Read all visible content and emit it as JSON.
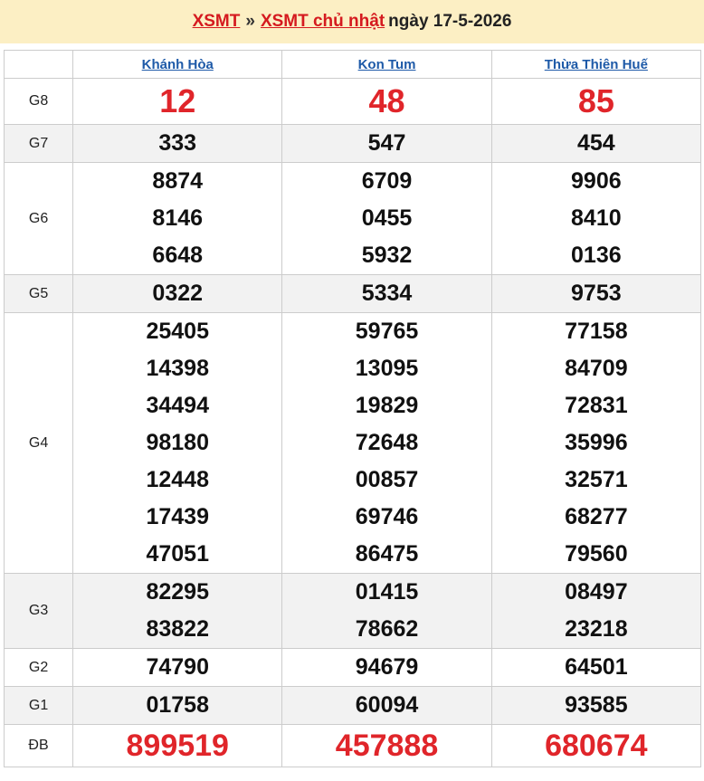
{
  "header": {
    "link1": "XSMT",
    "separator": "»",
    "link2": "XSMT chủ nhật",
    "date_text": "ngày 17-5-2026"
  },
  "provinces": [
    "Khánh Hòa",
    "Kon Tum",
    "Thừa Thiên Huế"
  ],
  "prizes": [
    {
      "label": "G8",
      "values": [
        [
          "12"
        ],
        [
          "48"
        ],
        [
          "85"
        ]
      ]
    },
    {
      "label": "G7",
      "values": [
        [
          "333"
        ],
        [
          "547"
        ],
        [
          "454"
        ]
      ]
    },
    {
      "label": "G6",
      "values": [
        [
          "8874",
          "8146",
          "6648"
        ],
        [
          "6709",
          "0455",
          "5932"
        ],
        [
          "9906",
          "8410",
          "0136"
        ]
      ]
    },
    {
      "label": "G5",
      "values": [
        [
          "0322"
        ],
        [
          "5334"
        ],
        [
          "9753"
        ]
      ]
    },
    {
      "label": "G4",
      "values": [
        [
          "25405",
          "14398",
          "34494",
          "98180",
          "12448",
          "17439",
          "47051"
        ],
        [
          "59765",
          "13095",
          "19829",
          "72648",
          "00857",
          "69746",
          "86475"
        ],
        [
          "77158",
          "84709",
          "72831",
          "35996",
          "32571",
          "68277",
          "79560"
        ]
      ]
    },
    {
      "label": "G3",
      "values": [
        [
          "82295",
          "83822"
        ],
        [
          "01415",
          "78662"
        ],
        [
          "08497",
          "23218"
        ]
      ]
    },
    {
      "label": "G2",
      "values": [
        [
          "74790"
        ],
        [
          "94679"
        ],
        [
          "64501"
        ]
      ]
    },
    {
      "label": "G1",
      "values": [
        [
          "01758"
        ],
        [
          "60094"
        ],
        [
          "93585"
        ]
      ]
    },
    {
      "label": "ĐB",
      "values": [
        [
          "899519"
        ],
        [
          "457888"
        ],
        [
          "680674"
        ]
      ]
    }
  ]
}
